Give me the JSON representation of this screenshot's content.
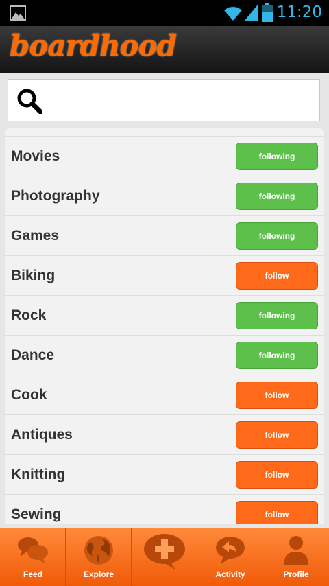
{
  "status_bar": {
    "time": "11:20",
    "icons": [
      "image-icon",
      "wifi-icon",
      "signal-icon",
      "battery-icon"
    ]
  },
  "header": {
    "logo_text": "boardhood"
  },
  "search": {
    "placeholder": ""
  },
  "topics": [
    {
      "label": "Movies",
      "button": "following",
      "state": "following"
    },
    {
      "label": "Photography",
      "button": "following",
      "state": "following"
    },
    {
      "label": "Games",
      "button": "following",
      "state": "following"
    },
    {
      "label": "Biking",
      "button": "follow",
      "state": "follow"
    },
    {
      "label": "Rock",
      "button": "following",
      "state": "following"
    },
    {
      "label": "Dance",
      "button": "following",
      "state": "following"
    },
    {
      "label": "Cook",
      "button": "follow",
      "state": "follow"
    },
    {
      "label": "Antiques",
      "button": "follow",
      "state": "follow"
    },
    {
      "label": "Knitting",
      "button": "follow",
      "state": "follow"
    },
    {
      "label": "Sewing",
      "button": "follow",
      "state": "follow"
    }
  ],
  "bottom_nav": [
    {
      "label": "Feed",
      "icon": "speech-bubbles-icon"
    },
    {
      "label": "Explore",
      "icon": "globe-icon"
    },
    {
      "label": "",
      "icon": "plus-bubble-icon"
    },
    {
      "label": "Activity",
      "icon": "reply-bubble-icon"
    },
    {
      "label": "Profile",
      "icon": "person-icon"
    }
  ],
  "colors": {
    "brand_orange": "#ff6a00",
    "following_green": "#5cc04b",
    "follow_orange": "#ff6a1a",
    "status_blue": "#33b5e5"
  }
}
